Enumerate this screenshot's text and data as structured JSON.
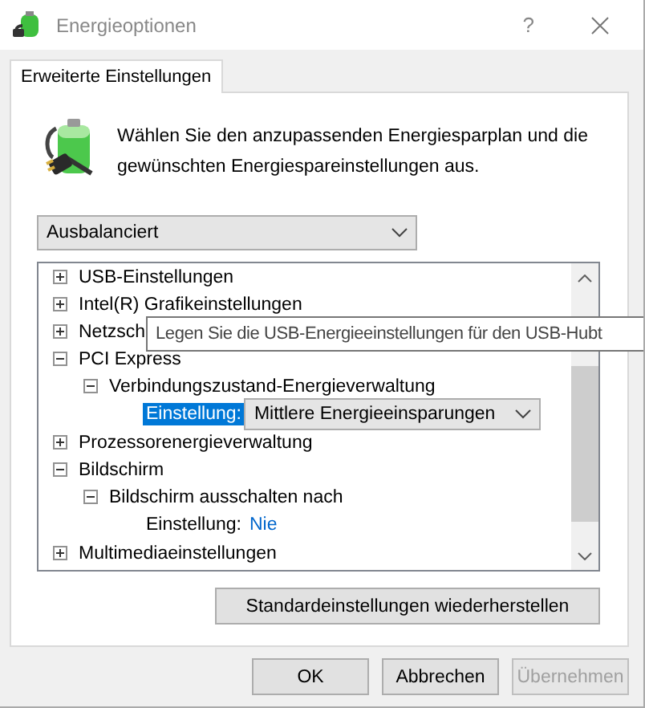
{
  "window": {
    "title": "Energieoptionen",
    "help": "?"
  },
  "tabs": [
    {
      "label": "Erweiterte Einstellungen",
      "selected": true
    }
  ],
  "description": "Wählen Sie den anzupassenden Energiesparplan und die gewünschten Energiespareinstellungen aus.",
  "plan_dropdown": {
    "value": "Ausbalanciert"
  },
  "tree": [
    {
      "kind": "group",
      "label": "USB-Einstellungen",
      "expanded": false
    },
    {
      "kind": "group",
      "label": "Intel(R) Grafikeinstellungen",
      "expanded": false
    },
    {
      "kind": "group",
      "label": "Netzsch",
      "expanded": false
    },
    {
      "kind": "group",
      "label": "PCI Express",
      "expanded": true,
      "children": [
        {
          "kind": "group",
          "label": "Verbindungszustand-Energieverwaltung",
          "expanded": true,
          "children": [
            {
              "kind": "setting",
              "label": "Einstellung:",
              "value": "Mittlere Energieeinsparungen",
              "selected": true
            }
          ]
        }
      ]
    },
    {
      "kind": "group",
      "label": "Prozessorenergieverwaltung",
      "expanded": false
    },
    {
      "kind": "group",
      "label": "Bildschirm",
      "expanded": true,
      "children": [
        {
          "kind": "group",
          "label": "Bildschirm ausschalten nach",
          "expanded": true,
          "children": [
            {
              "kind": "setting",
              "label": "Einstellung:",
              "value": "Nie",
              "selected": false
            }
          ]
        }
      ]
    },
    {
      "kind": "group",
      "label": "Multimediaeinstellungen",
      "expanded": false
    }
  ],
  "tooltip": "Legen Sie die USB-Energieeinstellungen für den USB-Hubt",
  "restore_button": "Standardeinstellungen wiederherstellen",
  "buttons": [
    {
      "label": "OK",
      "disabled": false
    },
    {
      "label": "Abbrechen",
      "disabled": false
    },
    {
      "label": "Übernehmen",
      "disabled": true
    }
  ]
}
